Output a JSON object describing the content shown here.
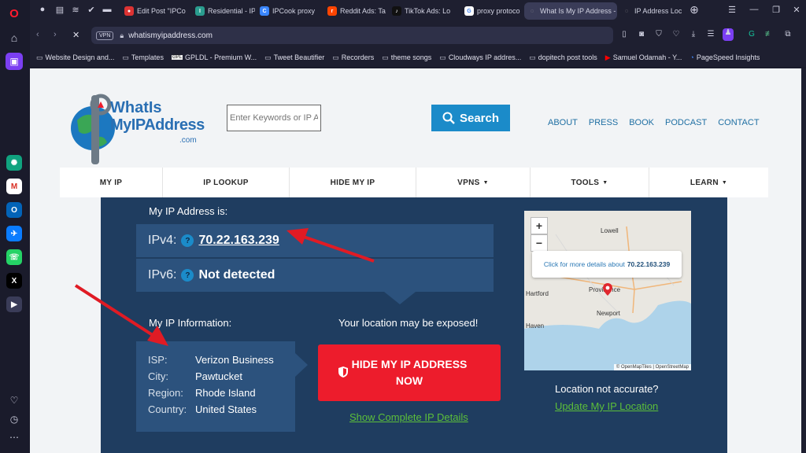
{
  "tabs": [
    {
      "label": "Edit Post \"IPCo",
      "color": "#d33"
    },
    {
      "label": "Residential - IP",
      "color": "#2a9d8f"
    },
    {
      "label": "IPCook proxy",
      "color": "#3a86ff"
    },
    {
      "label": "Reddit Ads: Ta",
      "color": "#ff4500"
    },
    {
      "label": "TikTok Ads: Lo",
      "color": "#111"
    },
    {
      "label": "proxy protoco",
      "color": "#4285f4"
    },
    {
      "label": "What Is My IP Address -",
      "color": "#777"
    },
    {
      "label": "IP Address Loc",
      "color": "#777"
    }
  ],
  "address_bar": {
    "vpn_label": "VPN",
    "url": "whatismyipaddress.com"
  },
  "bookmarks": [
    "Website Design and...",
    "Templates",
    "GPLDL - Premium W...",
    "Tweet Beautifier",
    "Recorders",
    "theme songs",
    "Cloudways IP addres...",
    "dopitech post tools",
    "Samuel Odamah - Y...",
    "PageSpeed Insights"
  ],
  "site": {
    "logo": {
      "line1": "WhatIs",
      "line2": "MyIPAddress",
      "line3": ".com"
    },
    "search_placeholder": "Enter Keywords or IP Ac",
    "search_button": "Search",
    "top_nav": [
      "ABOUT",
      "PRESS",
      "BOOK",
      "PODCAST",
      "CONTACT"
    ],
    "main_nav": [
      {
        "label": "MY IP",
        "dropdown": false
      },
      {
        "label": "IP LOOKUP",
        "dropdown": false
      },
      {
        "label": "HIDE MY IP",
        "dropdown": false
      },
      {
        "label": "VPNS",
        "dropdown": true
      },
      {
        "label": "TOOLS",
        "dropdown": true
      },
      {
        "label": "LEARN",
        "dropdown": true
      }
    ]
  },
  "ip": {
    "heading": "My IP Address is:",
    "ipv4_label": "IPv4:",
    "ipv4_value": "70.22.163.239",
    "ipv6_label": "IPv6:",
    "ipv6_value": "Not detected",
    "help": "?"
  },
  "info": {
    "heading": "My IP Information:",
    "rows": [
      {
        "key": "ISP:",
        "value": "Verizon Business"
      },
      {
        "key": "City:",
        "value": "Pawtucket"
      },
      {
        "key": "Region:",
        "value": "Rhode Island"
      },
      {
        "key": "Country:",
        "value": "United States"
      }
    ]
  },
  "exposure": {
    "warning": "Your location may be exposed!",
    "hide_button": "HIDE MY IP ADDRESS NOW",
    "details_link": "Show Complete IP Details"
  },
  "map": {
    "popup_prefix": "Click for more details about",
    "popup_ip": "70.22.163.239",
    "cities": [
      "Lowell",
      "Hartford",
      "Providence",
      "Newport",
      "Haven"
    ],
    "attribution": "© OpenMapTiles | OpenStreetMap",
    "zoom_in": "+",
    "zoom_out": "−",
    "not_accurate": "Location not accurate?",
    "update_link": "Update My IP Location"
  },
  "colors": {
    "page_bg": "#f2f4f6",
    "panel": "#1f3d60",
    "panel_box": "#2c527d",
    "accent": "#1b8bc9",
    "danger": "#ed1c2c",
    "link_green": "#5cbf3a"
  }
}
